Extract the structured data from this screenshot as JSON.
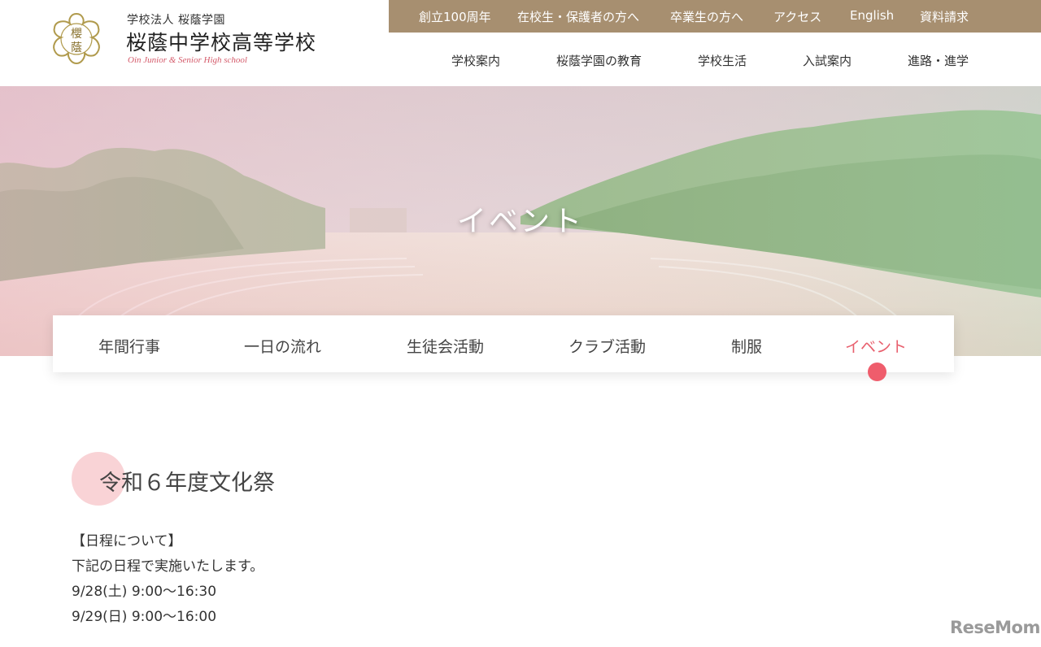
{
  "header": {
    "corporation": "学校法人 桜蔭学園",
    "school_name": "桜蔭中学校高等学校",
    "school_name_en": "Oin Junior & Senior High school",
    "logo_text": [
      "櫻",
      "蔭"
    ],
    "top_links": [
      "創立100周年",
      "在校生・保護者の方へ",
      "卒業生の方へ",
      "アクセス",
      "English",
      "資料請求"
    ],
    "main_links": [
      "学校案内",
      "桜蔭学園の教育",
      "学校生活",
      "入試案内",
      "進路・進学"
    ]
  },
  "hero": {
    "title": "イベント"
  },
  "subnav": {
    "items": [
      "年間行事",
      "一日の流れ",
      "生徒会活動",
      "クラブ活動",
      "制服",
      "イベント"
    ],
    "active": "イベント"
  },
  "content": {
    "title": "令和６年度文化祭",
    "lines": [
      "【日程について】",
      "下記の日程で実施いたします。",
      "9/28(土) 9:00〜16:30",
      "9/29(日) 9:00〜16:00"
    ]
  },
  "watermark": "ReseMom",
  "colors": {
    "topbar": "#a78f70",
    "accent": "#ef5d6c",
    "heading_circle": "#f9d3d6"
  }
}
